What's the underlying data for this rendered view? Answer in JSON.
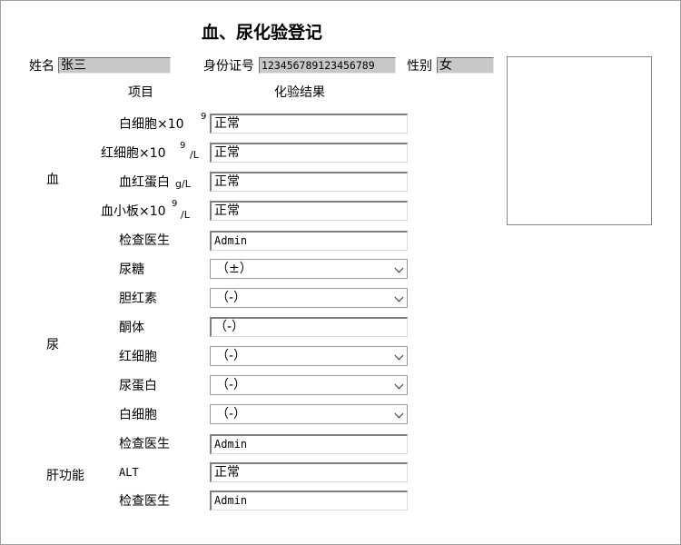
{
  "title": "血、尿化验登记",
  "patient": {
    "name_label": "姓名",
    "name_value": "张三",
    "id_label": "身份证号",
    "id_value": "123456789123456789",
    "sex_label": "性别",
    "sex_value": "女"
  },
  "headers": {
    "item": "项目",
    "result": "化验结果"
  },
  "sections": {
    "blood": "血",
    "urine": "尿",
    "liver": "肝功能"
  },
  "blood": {
    "wbc_label": "白细胞×10",
    "wbc_sup": "9",
    "wbc_value": "正常",
    "rbc_label": "红细胞×10",
    "rbc_sup": "9",
    "rbc_unit": "/L",
    "rbc_value": "正常",
    "hgb_label": "血红蛋白",
    "hgb_unit": "g/L",
    "hgb_value": "正常",
    "plt_label": "血小板×10",
    "plt_sup": "9",
    "plt_unit": "/L",
    "plt_value": "正常",
    "doctor_label": "检查医生",
    "doctor_value": "Admin"
  },
  "urine": {
    "glucose_label": "尿糖",
    "glucose_value": "（±）",
    "bilirubin_label": "胆红素",
    "bilirubin_value": "（-）",
    "ketone_label": "酮体",
    "ketone_value": "（-）",
    "rbc_label": "红细胞",
    "rbc_value": "（-）",
    "protein_label": "尿蛋白",
    "protein_value": "（-）",
    "wbc_label": "白细胞",
    "wbc_value": "（-）",
    "doctor_label": "检查医生",
    "doctor_value": "Admin"
  },
  "liver": {
    "alt_label": "ALT",
    "alt_value": "正常",
    "doctor_label": "检查医生",
    "doctor_value": "Admin"
  }
}
